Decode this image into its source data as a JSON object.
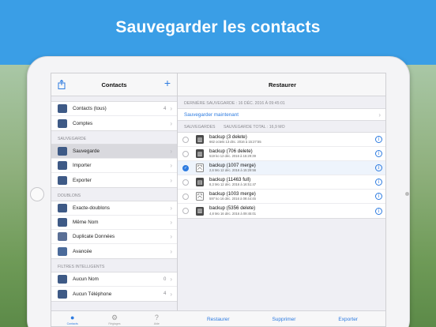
{
  "banner": {
    "title": "Sauvegarder les contacts"
  },
  "left": {
    "title": "Contacts",
    "top_items": [
      {
        "label": "Contacts (tous)",
        "count": "4"
      },
      {
        "label": "Comptes",
        "count": ""
      }
    ],
    "sections": [
      {
        "header": "SAUVEGARDE",
        "items": [
          {
            "label": "Sauvegarde",
            "count": ""
          },
          {
            "label": "Importer",
            "count": ""
          },
          {
            "label": "Exporter",
            "count": ""
          }
        ]
      },
      {
        "header": "DOUBLONS",
        "items": [
          {
            "label": "Exacte-doublons",
            "count": ""
          },
          {
            "label": "Même Nom",
            "count": ""
          },
          {
            "label": "Duplicate Données",
            "count": ""
          },
          {
            "label": "Avancée",
            "count": ""
          }
        ]
      },
      {
        "header": "FILTRES INTELLIGENTS",
        "items": [
          {
            "label": "Aucun Nom",
            "count": "0"
          },
          {
            "label": "Aucun Téléphone",
            "count": "4"
          }
        ]
      }
    ],
    "tabs": [
      {
        "label": "Contacts"
      },
      {
        "label": "Réglages"
      },
      {
        "label": "Aide"
      }
    ]
  },
  "right": {
    "title": "Restaurer",
    "last_backup": "DERNIÈRE SAUVEGARDE : 16 DÉC. 2016 À 09:45:01",
    "backup_now": "Sauvegarder maintenant",
    "backups_header": "SAUVEGARDES",
    "total_header": "SAUVEGARDE TOTAL : 16,9 MO",
    "backups": [
      {
        "name": "backup (3 delete)",
        "meta": "662 octets  13 déc. 2016 à 15:27:55"
      },
      {
        "name": "backup (706 delete)",
        "meta": "519 ko  12 déc. 2016 à 15:29:39"
      },
      {
        "name": "backup (1007 merge)",
        "meta": "2,6 Mo  12 déc. 2016 à 15:29:56"
      },
      {
        "name": "backup (11463 full)",
        "meta": "8,3 Mo  12 déc. 2016 à 16:51:47"
      },
      {
        "name": "backup (1003 merge)",
        "meta": "597 ko  16 déc. 2016 à 09:44:45"
      },
      {
        "name": "backup (5356 delete)",
        "meta": "4,8 Mo  16 déc. 2016 à 09:45:01"
      }
    ],
    "toolbar": {
      "restore": "Restaurer",
      "delete": "Supprimer",
      "export": "Exporter"
    }
  }
}
